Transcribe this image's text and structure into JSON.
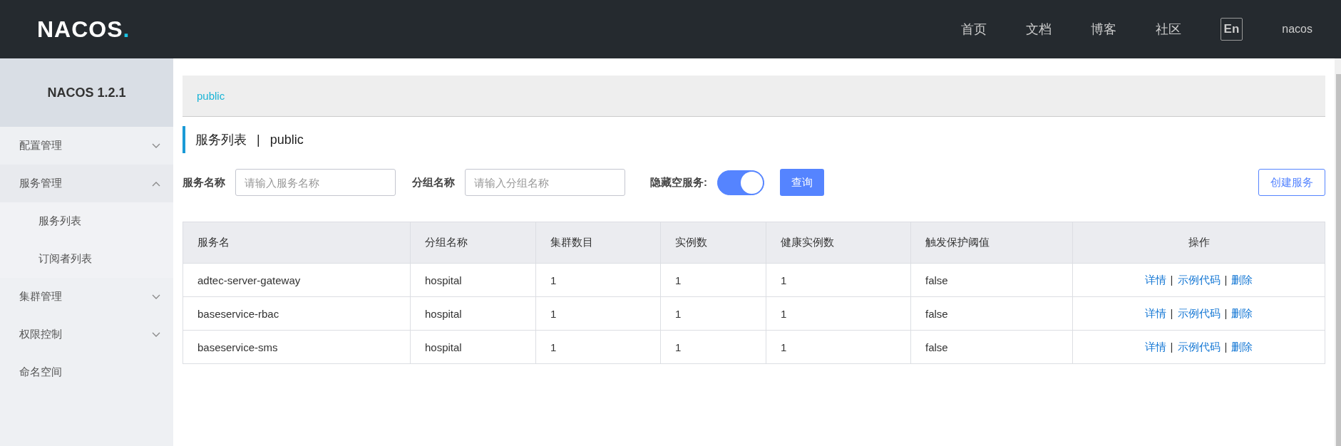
{
  "header": {
    "logo": "NACOS.",
    "nav": [
      "首页",
      "文档",
      "博客",
      "社区"
    ],
    "language": "En",
    "user": "nacos"
  },
  "sidebar": {
    "title": "NACOS 1.2.1",
    "items": [
      {
        "label": "配置管理",
        "expanded": false
      },
      {
        "label": "服务管理",
        "expanded": true,
        "children": [
          {
            "label": "服务列表"
          },
          {
            "label": "订阅者列表"
          }
        ]
      },
      {
        "label": "集群管理",
        "expanded": false
      },
      {
        "label": "权限控制",
        "expanded": false
      },
      {
        "label": "命名空间"
      }
    ]
  },
  "breadcrumb": "public",
  "page_title": {
    "title": "服务列表",
    "separator": "|",
    "namespace": "public"
  },
  "filters": {
    "service_name": {
      "label": "服务名称",
      "placeholder": "请输入服务名称"
    },
    "group_name": {
      "label": "分组名称",
      "placeholder": "请输入分组名称"
    },
    "hide_empty": {
      "label": "隐藏空服务:",
      "on": true
    },
    "query_button": "查询",
    "create_button": "创建服务"
  },
  "table": {
    "columns": [
      "服务名",
      "分组名称",
      "集群数目",
      "实例数",
      "健康实例数",
      "触发保护阈值",
      "操作"
    ],
    "rows": [
      {
        "cells": [
          "adtec-server-gateway",
          "hospital",
          "1",
          "1",
          "1",
          "false"
        ],
        "actions": [
          "详情",
          "示例代码",
          "删除"
        ]
      },
      {
        "cells": [
          "baseservice-rbac",
          "hospital",
          "1",
          "1",
          "1",
          "false"
        ],
        "actions": [
          "详情",
          "示例代码",
          "删除"
        ]
      },
      {
        "cells": [
          "baseservice-sms",
          "hospital",
          "1",
          "1",
          "1",
          "false"
        ],
        "actions": [
          "详情",
          "示例代码",
          "删除"
        ]
      }
    ]
  }
}
